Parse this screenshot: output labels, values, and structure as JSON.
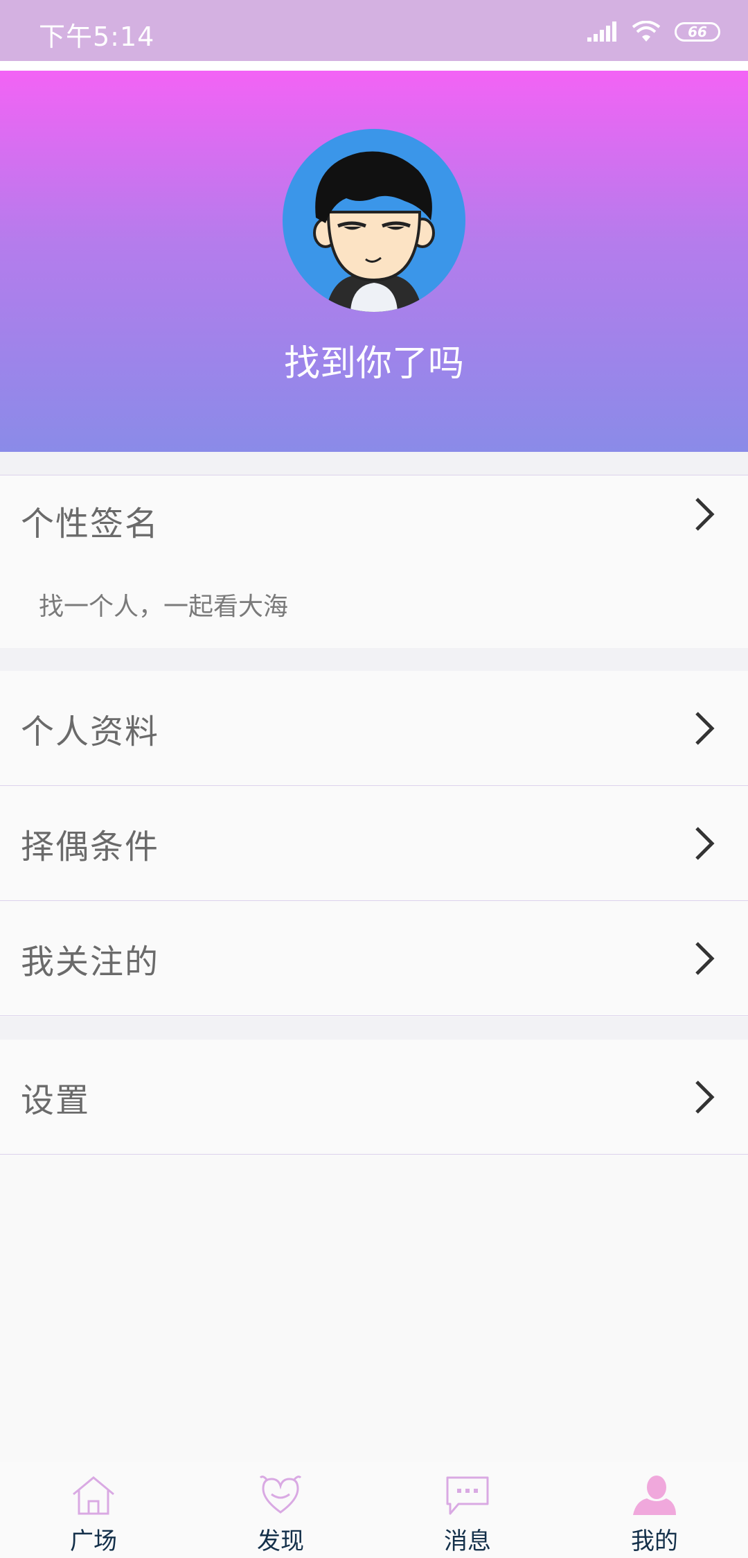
{
  "status_bar": {
    "time": "下午5:14",
    "battery": "66"
  },
  "profile": {
    "name": "找到你了吗"
  },
  "signature": {
    "label": "个性签名",
    "text": "找一个人，一起看大海"
  },
  "menu": [
    {
      "label": "个人资料"
    },
    {
      "label": "择偶条件"
    },
    {
      "label": "我关注的"
    }
  ],
  "settings": {
    "label": "设置"
  },
  "tabbar": {
    "items": [
      {
        "label": "广场",
        "icon": "home-icon"
      },
      {
        "label": "发现",
        "icon": "heart-icon"
      },
      {
        "label": "消息",
        "icon": "message-icon"
      },
      {
        "label": "我的",
        "icon": "user-icon"
      }
    ],
    "active_index": 3
  },
  "colors": {
    "status_bar": "#d4b1e1",
    "header_gradient_top": "#f363f5",
    "header_gradient_bottom": "#8a8be8",
    "avatar_bg": "#3b96e9",
    "tab_icon": "#d9a9e3",
    "tab_icon_active": "#f0a8dc",
    "tab_label": "#14304a"
  }
}
